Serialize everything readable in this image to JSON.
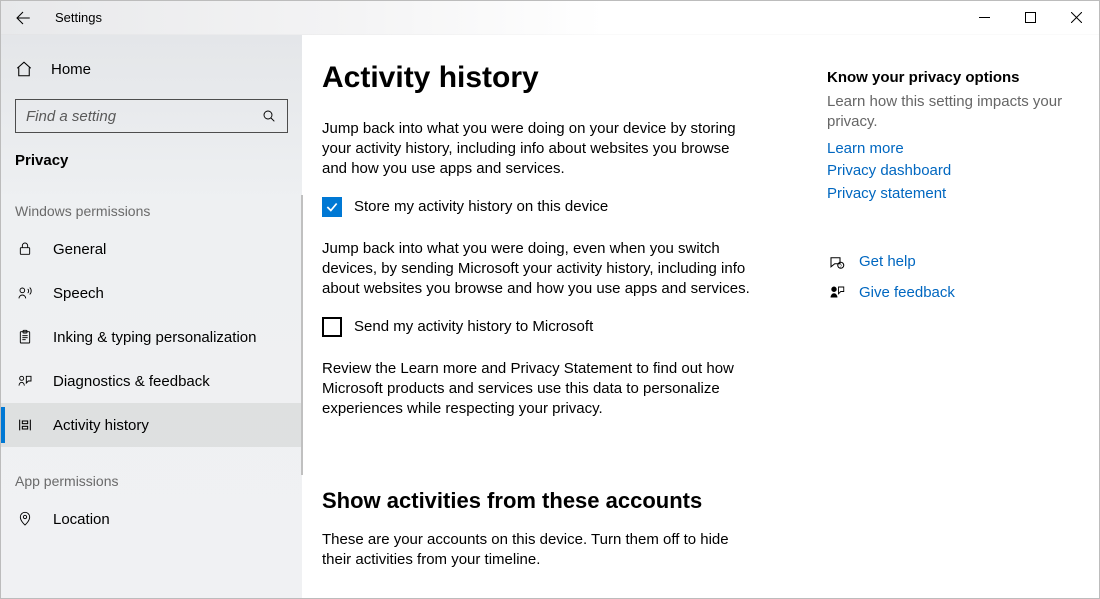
{
  "window": {
    "title": "Settings"
  },
  "sidebar": {
    "home_label": "Home",
    "search_placeholder": "Find a setting",
    "section": "Privacy",
    "group_windows": "Windows permissions",
    "group_app": "App permissions",
    "items_windows": [
      {
        "icon": "lock",
        "label": "General"
      },
      {
        "icon": "speech",
        "label": "Speech"
      },
      {
        "icon": "clipboard",
        "label": "Inking & typing personalization"
      },
      {
        "icon": "feedback",
        "label": "Diagnostics & feedback"
      },
      {
        "icon": "timeline",
        "label": "Activity history"
      }
    ],
    "items_app": [
      {
        "icon": "location",
        "label": "Location"
      }
    ],
    "selected_label": "Activity history"
  },
  "main": {
    "heading": "Activity history",
    "para1": "Jump back into what you were doing on your device by storing your activity history, including info about websites you browse and how you use apps and services.",
    "checkbox1": {
      "label": "Store my activity history on this device",
      "checked": true
    },
    "para2": "Jump back into what you were doing, even when you switch devices, by sending Microsoft your activity history, including info about websites you browse and how you use apps and services.",
    "checkbox2": {
      "label": "Send my activity history to Microsoft",
      "checked": false
    },
    "para3": "Review the Learn more and Privacy Statement to find out how Microsoft products and services use this data to personalize experiences while respecting your privacy.",
    "subheading": "Show activities from these accounts",
    "para4": "These are your accounts on this device. Turn them off to hide their activities from your timeline."
  },
  "aside": {
    "heading1": "Know your privacy options",
    "text1": "Learn how this setting impacts your privacy.",
    "links1": [
      "Learn more",
      "Privacy dashboard",
      "Privacy statement"
    ],
    "help_link": "Get help",
    "feedback_link": "Give feedback"
  }
}
